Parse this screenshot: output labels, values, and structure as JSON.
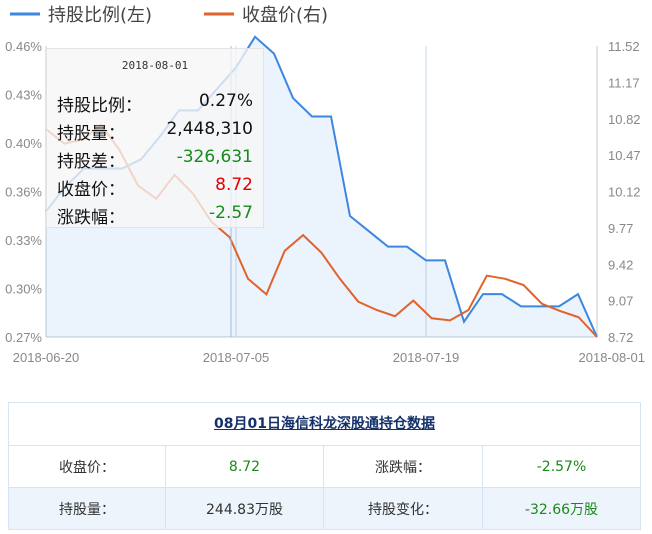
{
  "chart_data": {
    "type": "line",
    "legend": [
      {
        "name": "持股比例(左)",
        "color": "#3c87e0"
      },
      {
        "name": "收盘价(右)",
        "color": "#e0622c"
      }
    ],
    "x_ticks": [
      "2018-06-20",
      "2018-07-05",
      "2018-07-19",
      "2018-08-01"
    ],
    "y_left_ticks": [
      "0.27%",
      "0.30%",
      "0.33%",
      "0.36%",
      "0.40%",
      "0.43%",
      "0.46%"
    ],
    "y_right_ticks": [
      "8.72",
      "9.07",
      "9.42",
      "9.77",
      "10.12",
      "10.47",
      "10.82",
      "11.17",
      "11.52"
    ],
    "ylim_left": [
      0.27,
      0.46
    ],
    "ylim_right": [
      8.72,
      11.52
    ],
    "series": [
      {
        "name": "持股比例(左)",
        "axis": "left",
        "color": "#3c87e0",
        "values": [
          0.352,
          0.368,
          0.38,
          0.38,
          0.38,
          0.386,
          0.401,
          0.418,
          0.418,
          0.432,
          0.446,
          0.466,
          0.455,
          0.426,
          0.414,
          0.414,
          0.349,
          0.339,
          0.329,
          0.329,
          0.32,
          0.32,
          0.28,
          0.298,
          0.298,
          0.29,
          0.29,
          0.29,
          0.298,
          0.27
        ]
      },
      {
        "name": "收盘价(右)",
        "axis": "right",
        "color": "#e0622c",
        "values": [
          10.72,
          10.58,
          10.62,
          10.76,
          10.52,
          10.18,
          10.05,
          10.28,
          10.1,
          9.83,
          9.68,
          9.28,
          9.13,
          9.55,
          9.7,
          9.53,
          9.28,
          9.06,
          8.98,
          8.92,
          9.07,
          8.9,
          8.88,
          8.98,
          9.31,
          9.28,
          9.22,
          9.04,
          8.97,
          8.91,
          8.72
        ]
      }
    ],
    "highlight_index": 29,
    "vlines": [
      10,
      20
    ]
  },
  "tooltip": {
    "date": "2018-08-01",
    "rows": [
      {
        "label": "持股比例：",
        "value": "0.27%",
        "tone": "normal"
      },
      {
        "label": "持股量：",
        "value": "2,448,310",
        "tone": "normal"
      },
      {
        "label": "持股差：",
        "value": "-326,631",
        "tone": "green"
      },
      {
        "label": "收盘价：",
        "value": "8.72",
        "tone": "red"
      },
      {
        "label": "涨跌幅：",
        "value": "-2.57",
        "tone": "green"
      }
    ]
  },
  "table": {
    "title": "08月01日海信科龙深股通持仓数据",
    "row1": {
      "label1": "收盘价：",
      "value1": "8.72",
      "label2": "涨跌幅：",
      "value2": "-2.57%"
    },
    "row2": {
      "label1": "持股量：",
      "value1": "244.83万股",
      "label2": "持股变化：",
      "value2": "-32.66万股"
    }
  }
}
